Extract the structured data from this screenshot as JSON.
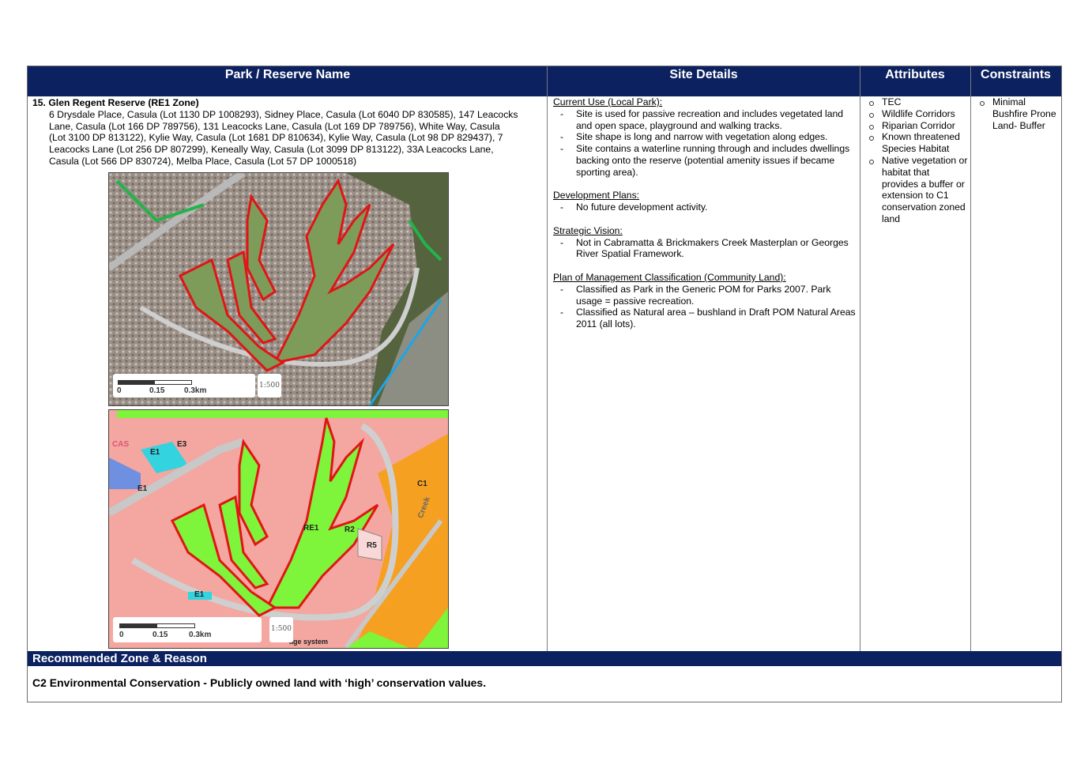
{
  "header": {
    "col1": "Park / Reserve Name",
    "col2": "Site Details",
    "col3": "Attributes",
    "col4": "Constraints"
  },
  "reserve": {
    "title": "15. Glen Regent Reserve (RE1 Zone)",
    "lines": [
      "6 Drysdale Place, Casula (Lot 1130 DP 1008293), Sidney Place, Casula (Lot 6040 DP 830585), 147 Leacocks",
      "Lane, Casula (Lot 166 DP 789756), 131 Leacocks Lane, Casula (Lot 169 DP  789756), White Way, Casula",
      "(Lot 3100 DP 813122), Kylie Way, Casula (Lot 1681 DP 810634), Kylie Way, Casula (Lot 98 DP 829437), 7",
      "Leacocks Lane (Lot 256 DP 807299), Keneally Way, Casula (Lot 3099 DP 813122), 33A Leacocks Lane,",
      "Casula (Lot 566 DP 830724), Melba Place, Casula (Lot 57 DP 1000518)"
    ]
  },
  "maps": {
    "aerial": {
      "scale_0": "0",
      "scale_mid": "0.15",
      "scale_end": "0.3km",
      "stamp": "1:500"
    },
    "zoning": {
      "scale_0": "0",
      "scale_mid": "0.15",
      "scale_end": "0.3km",
      "stamp": "1:500",
      "labels": {
        "e1a": "E1",
        "e3": "E3",
        "e1b": "E1",
        "c1": "C1",
        "re1": "RE1",
        "r2": "R2",
        "r5": "R5",
        "e1c": "E1",
        "cas": "CAS",
        "creek": "Creek",
        "system": "age system"
      }
    }
  },
  "site": {
    "current_use": {
      "heading": "Current Use (Local Park):",
      "items": [
        "Site is used for passive recreation and includes vegetated land and open space, playground and walking tracks.",
        "Site shape is long and narrow with vegetation along edges.",
        "Site contains a waterline running through and includes dwellings backing onto the reserve (potential amenity issues if became sporting area)."
      ]
    },
    "development": {
      "heading": "Development Plans:",
      "items": [
        "No future development activity."
      ]
    },
    "strategic": {
      "heading": "Strategic Vision:",
      "items": [
        "Not in Cabramatta & Brickmakers Creek Masterplan or Georges River Spatial Framework."
      ]
    },
    "pom": {
      "heading": "Plan of Management Classification (Community Land):",
      "items": [
        "Classified as Park in the Generic POM for Parks 2007. Park usage = passive recreation.",
        "Classified as Natural area – bushland in Draft POM Natural Areas 2011 (all lots)."
      ]
    }
  },
  "attributes": [
    "TEC",
    "Wildlife Corridors",
    "Riparian Corridor",
    "Known threatened Species Habitat",
    "Native vegetation or habitat that provides a buffer or extension to C1 conservation zoned land"
  ],
  "constraints": [
    "Minimal Bushfire Prone Land- Buffer"
  ],
  "recommended": {
    "heading": "Recommended Zone & Reason",
    "text": "C2 Environmental Conservation - Publicly owned land with ‘high’ conservation values."
  },
  "colors": {
    "header_bg": "#0b2160",
    "reserve_outline": "#e01515",
    "residential": "#f4a6a0",
    "conservation": "#f5a020",
    "recreation": "#7ef53a",
    "waterway": "#1aa6e8"
  }
}
